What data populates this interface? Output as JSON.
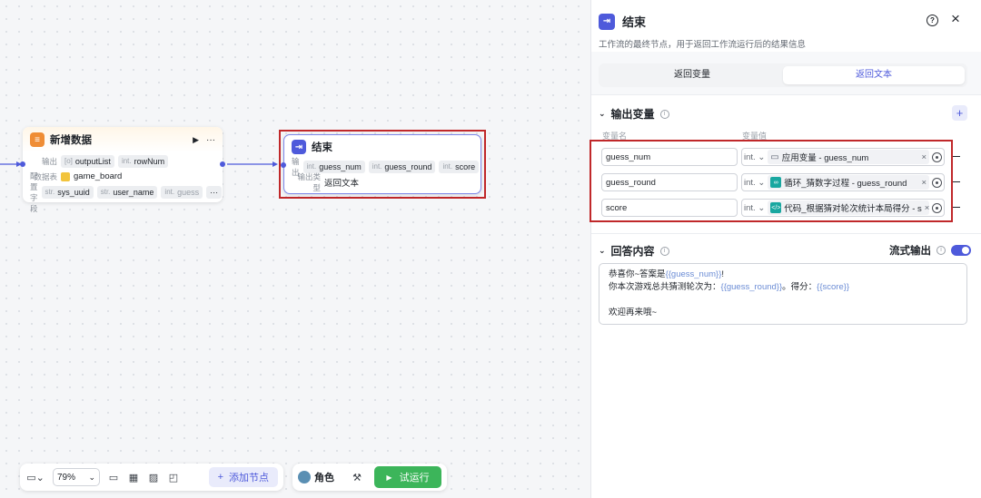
{
  "canvas": {
    "add_node": {
      "title": "新增数据",
      "output_label": "输出",
      "outputs": [
        {
          "type": "[o]",
          "name": "outputList"
        },
        {
          "type": "int.",
          "name": "rowNum"
        }
      ],
      "table_label": "数据表",
      "table_value": "game_board",
      "config_label": "配置字段",
      "fields": [
        {
          "type": "str.",
          "name": "sys_uuid"
        },
        {
          "type": "str.",
          "name": "user_name"
        },
        {
          "type": "int.",
          "name": "guess"
        }
      ],
      "more": "···"
    },
    "end_node": {
      "title": "结束",
      "output_label": "输出",
      "outputs": [
        {
          "type": "int.",
          "name": "guess_num"
        },
        {
          "type": "int.",
          "name": "guess_round"
        },
        {
          "type": "int.",
          "name": "score"
        }
      ],
      "type_label": "输出类型",
      "type_value": "返回文本"
    }
  },
  "toolbar": {
    "zoom": "79%",
    "add_node_label": "添加节点",
    "role_label": "角色",
    "run_label": "试运行"
  },
  "panel": {
    "title": "结束",
    "help_icon": "?",
    "close_icon": "×",
    "description": "工作流的最终节点，用于返回工作流运行后的结果信息",
    "tabs": [
      "返回变量",
      "返回文本"
    ],
    "output_section": {
      "title": "输出变量",
      "col_name": "变量名",
      "col_value": "变量值",
      "rows": [
        {
          "name": "guess_num",
          "type": "int.",
          "ref": "应用变量 - guess_num",
          "ref_color": "#5b6170"
        },
        {
          "name": "guess_round",
          "type": "int.",
          "ref": "循环_猜数字过程 - guess_round",
          "ref_color": "#19a7a0"
        },
        {
          "name": "score",
          "type": "int.",
          "ref": "代码_根据猜对轮次统计本局得分 - s",
          "ref_color": "#19a7a0"
        }
      ]
    },
    "reply_section": {
      "title": "回答内容",
      "stream_label": "流式输出",
      "stream_on": true,
      "line1_prefix": "恭喜你~答案是",
      "line1_var": "{{guess_num}}",
      "line1_suffix": "!",
      "line2_prefix": "你本次游戏总共猜测轮次为：",
      "line2_var": "{{guess_round}}",
      "line2_mid": "。得分：",
      "line2_var2": "{{score}}",
      "line3": "欢迎再来哦~"
    }
  },
  "colors": {
    "accent": "#4e5adb",
    "highlight_border": "#c0282a",
    "run_green": "#3cb55a",
    "add_node_orange": "#ef8d35"
  }
}
